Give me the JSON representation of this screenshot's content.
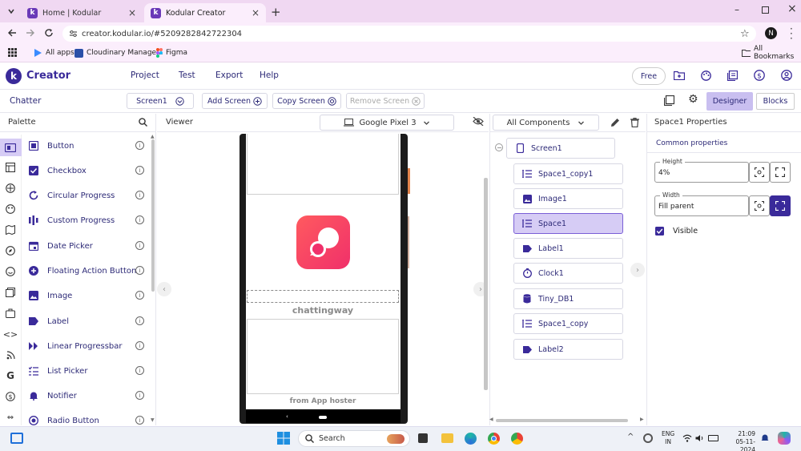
{
  "browser": {
    "tabs": [
      {
        "title": "Home | Kodular",
        "active": false
      },
      {
        "title": "Kodular Creator",
        "active": true
      }
    ],
    "url": "creator.kodular.io/#5209282842722304",
    "profile_initial": "N",
    "bookmarks": [
      "All apps",
      "Cloudinary Manage...",
      "Figma"
    ],
    "all_bookmarks": "All Bookmarks"
  },
  "app": {
    "brand": "Creator",
    "logo_letter": "k",
    "menu": [
      "Project",
      "Test",
      "Export",
      "Help"
    ],
    "plan_label": "Free",
    "project_name": "Chatter",
    "screen_select": "Screen1",
    "add_screen": "Add Screen",
    "copy_screen": "Copy Screen",
    "remove_screen": "Remove Screen",
    "designer_tab": "Designer",
    "blocks_tab": "Blocks"
  },
  "palette": {
    "title": "Palette",
    "items": [
      "Button",
      "Checkbox",
      "Circular Progress",
      "Custom Progress",
      "Date Picker",
      "Floating Action Button",
      "Image",
      "Label",
      "Linear Progressbar",
      "List Picker",
      "Notifier",
      "Radio Button"
    ],
    "info_glyph": "i"
  },
  "viewer": {
    "title": "Viewer",
    "device": "Google Pixel 3",
    "app_name_text": "chattingway",
    "footer_text": "from App hoster"
  },
  "components": {
    "dropdown": "All Components",
    "root": "Screen1",
    "children": [
      {
        "name": "Space1_copy1",
        "icon": "space-icon"
      },
      {
        "name": "Image1",
        "icon": "image-icon"
      },
      {
        "name": "Space1",
        "icon": "space-icon",
        "selected": true
      },
      {
        "name": "Label1",
        "icon": "label-icon"
      },
      {
        "name": "Clock1",
        "icon": "clock-icon"
      },
      {
        "name": "Tiny_DB1",
        "icon": "database-icon"
      },
      {
        "name": "Space1_copy",
        "icon": "space-icon"
      },
      {
        "name": "Label2",
        "icon": "label-icon"
      }
    ]
  },
  "properties": {
    "title": "Space1 Properties",
    "section": "Common properties",
    "height_label": "Height",
    "height_value": "4%",
    "width_label": "Width",
    "width_value": "Fill parent",
    "visible_label": "Visible",
    "visible_checked": true
  },
  "taskbar": {
    "search_placeholder": "Search",
    "lang_top": "ENG",
    "lang_bottom": "IN",
    "time": "21:09",
    "date": "05-11-2024"
  },
  "colors": {
    "accent": "#3a2a9a",
    "selected_bg": "#d6ccf5",
    "app_icon_gradient_top": "#ff5a5f",
    "app_icon_gradient_bottom": "#f0306a"
  }
}
